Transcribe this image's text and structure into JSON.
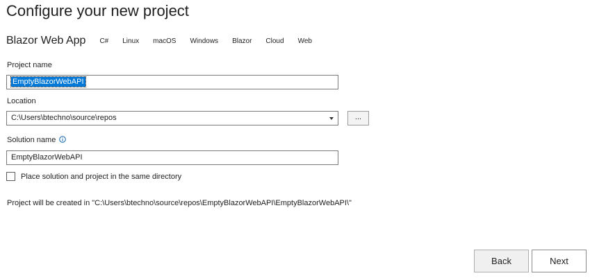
{
  "header": {
    "title": "Configure your new project"
  },
  "template": {
    "name": "Blazor Web App",
    "tags": [
      "C#",
      "Linux",
      "macOS",
      "Windows",
      "Blazor",
      "Cloud",
      "Web"
    ]
  },
  "form": {
    "project_name_label": "Project name",
    "project_name_value": "EmptyBlazorWebAPI",
    "location_label": "Location",
    "location_value": "C:\\Users\\btechno\\source\\repos",
    "browse_label": "...",
    "solution_name_label": "Solution name",
    "solution_name_value": "EmptyBlazorWebAPI",
    "same_directory_label": "Place solution and project in the same directory",
    "same_directory_checked": false,
    "created_path_text": "Project will be created in \"C:\\Users\\btechno\\source\\repos\\EmptyBlazorWebAPI\\EmptyBlazorWebAPI\\\""
  },
  "footer": {
    "back_label": "Back",
    "next_label": "Next"
  },
  "colors": {
    "selection": "#0078d7",
    "info_icon": "#0e63b4"
  },
  "icons": {
    "info": "info-icon",
    "dropdown": "chevron-down-icon"
  }
}
